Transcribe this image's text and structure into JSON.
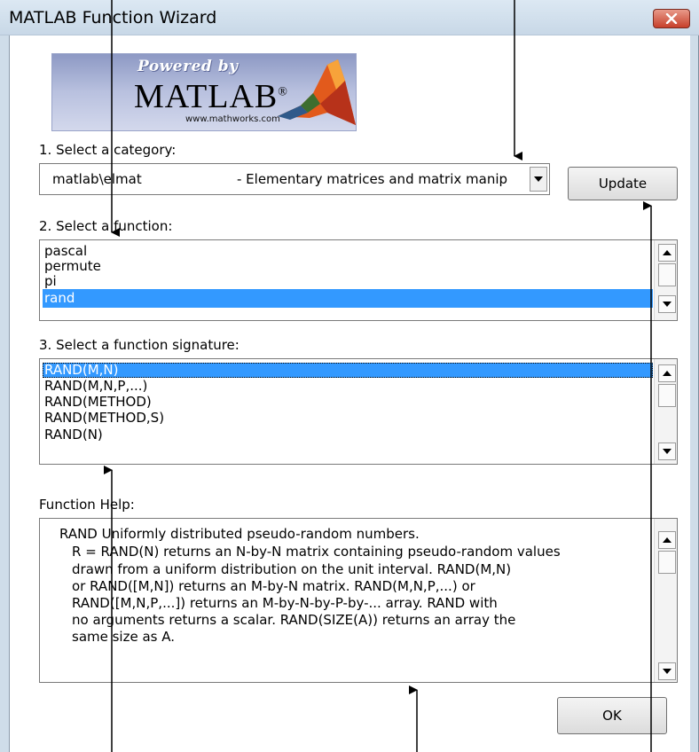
{
  "window": {
    "title": "MATLAB Function Wizard",
    "close_icon": "close-icon"
  },
  "logo": {
    "powered": "Powered by",
    "word": "MATLAB",
    "reg": "®",
    "url": "www.mathworks.com"
  },
  "category": {
    "label": "1. Select a category:",
    "selected_left": "matlab\\elmat",
    "selected_right": "- Elementary matrices and matrix manip",
    "update_label": "Update"
  },
  "functions": {
    "label": "2. Select a function:",
    "items": [
      "pascal",
      "permute",
      "pi",
      "rand"
    ],
    "selected_index": 3
  },
  "signatures": {
    "label": "3. Select a function signature:",
    "items": [
      "RAND(M,N)",
      "RAND(M,N,P,...)",
      "RAND(METHOD)",
      "RAND(METHOD,S)",
      "RAND(N)"
    ],
    "selected_index": 0
  },
  "help": {
    "label": "Function Help:",
    "lines": [
      "RAND   Uniformly distributed pseudo-random numbers.",
      "R = RAND(N) returns an N-by-N matrix containing pseudo-random values",
      "drawn from a uniform distribution on the unit interval.  RAND(M,N)",
      "or RAND([M,N]) returns an M-by-N matrix.  RAND(M,N,P,...) or",
      "RAND([M,N,P,...]) returns an M-by-N-by-P-by-... array.  RAND with",
      "no arguments returns a scalar.  RAND(SIZE(A)) returns an array the",
      "same size as A."
    ]
  },
  "ok_label": "OK",
  "colors": {
    "selection": "#3399ff",
    "titlebar": "#cfdde9",
    "close": "#c7402b"
  }
}
